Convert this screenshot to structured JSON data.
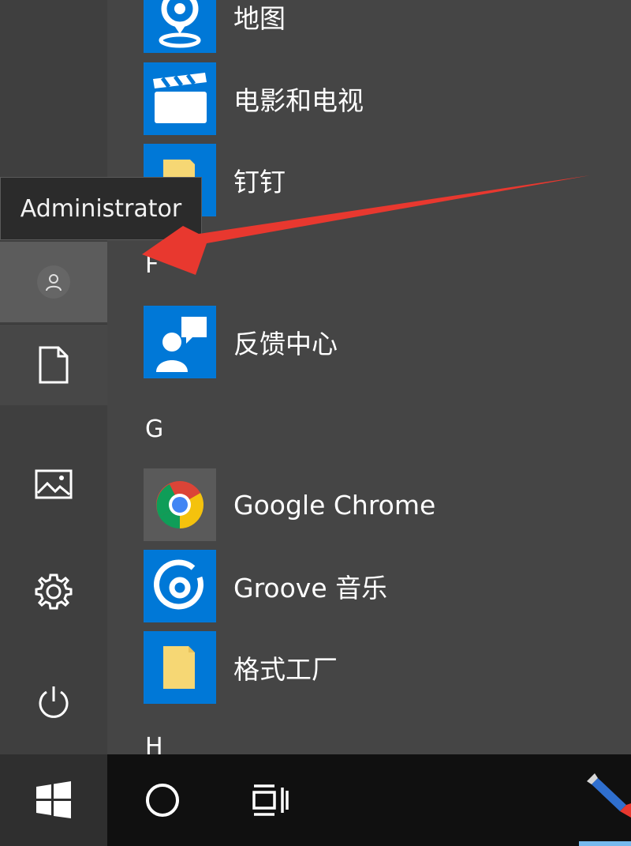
{
  "tooltip": {
    "text": "Administrator"
  },
  "rail": {
    "icons": [
      "user-icon",
      "document-icon",
      "pictures-icon",
      "gear-icon",
      "power-icon"
    ]
  },
  "apps": {
    "maps": {
      "label": "地图",
      "icon": "map-pin-icon"
    },
    "movies": {
      "label": "电影和电视",
      "icon": "clapperboard-icon"
    },
    "dingtalk": {
      "label": "钉钉",
      "icon": "folder-icon"
    },
    "group_f": "F",
    "feedback": {
      "label": "反馈中心",
      "icon": "feedback-person-icon"
    },
    "group_g": "G",
    "chrome": {
      "label": "Google Chrome",
      "icon": "chrome-icon"
    },
    "groove": {
      "label": "Groove 音乐",
      "icon": "groove-disc-icon"
    },
    "format_factory": {
      "label": "格式工厂",
      "icon": "folder-icon"
    },
    "group_h": "H"
  },
  "taskbar": {
    "icons": [
      "windows-logo-icon",
      "cortana-circle-icon",
      "task-view-icon",
      "pen-app-icon"
    ]
  },
  "colors": {
    "tile_blue": "#0078d7",
    "menu_bg": "#454545",
    "taskbar_bg": "#101010",
    "arrow_red": "#e8382f"
  }
}
